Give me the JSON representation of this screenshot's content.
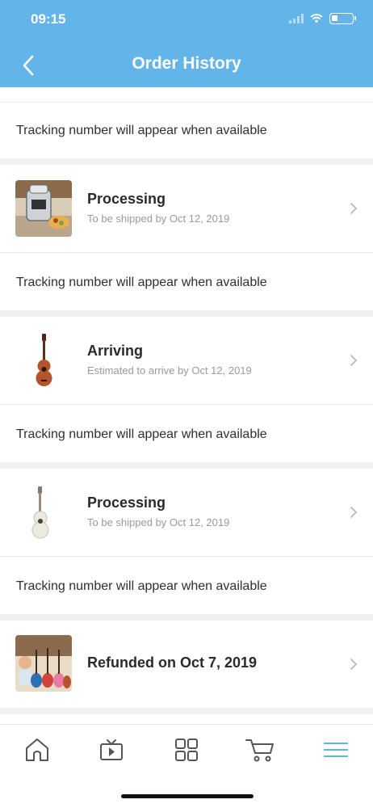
{
  "status_bar": {
    "time": "09:15"
  },
  "header": {
    "title": "Order History",
    "back_icon": "chevron-left-icon"
  },
  "tracking_message": "Tracking number will appear when available",
  "orders": [
    {
      "status": "Processing",
      "subtitle": "To be shipped by Oct 12, 2019",
      "image": "air-fryer-product-image"
    },
    {
      "status": "Arriving",
      "subtitle": "Estimated to arrive by Oct 12, 2019",
      "image": "brown-ukulele-product-image"
    },
    {
      "status": "Processing",
      "subtitle": "To be shipped by Oct 12, 2019",
      "image": "white-ukulele-product-image"
    },
    {
      "status": "Refunded on Oct 7, 2019",
      "subtitle": "",
      "image": "kids-guitars-product-image"
    }
  ],
  "tab_bar": {
    "tabs": [
      {
        "name": "home",
        "icon": "home-icon"
      },
      {
        "name": "video",
        "icon": "tv-play-icon"
      },
      {
        "name": "categories",
        "icon": "grid-icon"
      },
      {
        "name": "cart",
        "icon": "cart-icon"
      },
      {
        "name": "menu",
        "icon": "hamburger-menu-icon",
        "active": true
      }
    ]
  },
  "colors": {
    "header": "#63b5e9",
    "active_tab": "#63b5e9",
    "page_background": "#eef0f2"
  }
}
